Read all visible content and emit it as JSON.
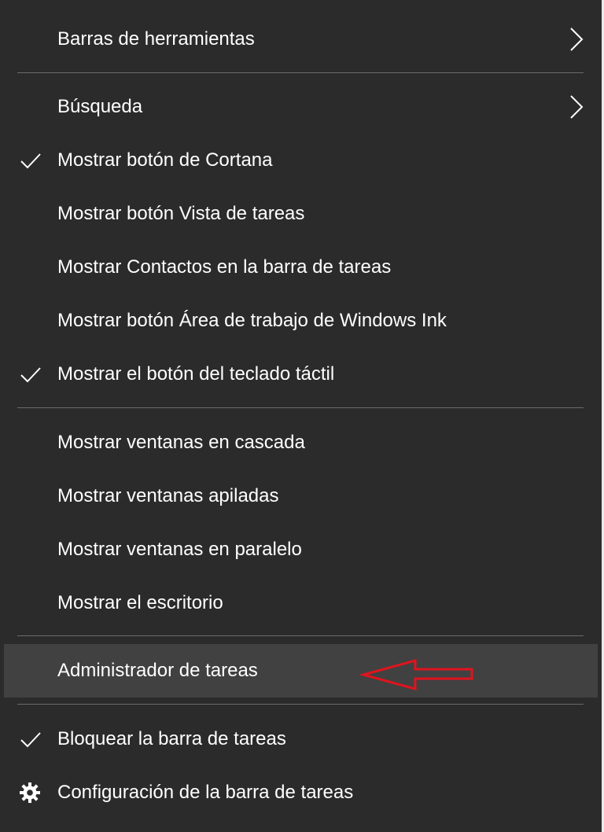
{
  "menu": {
    "items": [
      {
        "label": "Barras de herramientas",
        "checked": false,
        "submenu": true,
        "icon": "chevron-right-icon"
      },
      {
        "label": "Búsqueda",
        "checked": false,
        "submenu": true,
        "icon": "chevron-right-icon"
      },
      {
        "label": "Mostrar botón de Cortana",
        "checked": true,
        "icon": "checkmark-icon"
      },
      {
        "label": "Mostrar botón Vista de tareas",
        "checked": false
      },
      {
        "label": "Mostrar Contactos en la barra de tareas",
        "checked": false
      },
      {
        "label": "Mostrar botón Área de trabajo de Windows Ink",
        "checked": false
      },
      {
        "label": "Mostrar el botón del teclado táctil",
        "checked": true,
        "icon": "checkmark-icon"
      },
      {
        "label": "Mostrar ventanas en cascada",
        "checked": false
      },
      {
        "label": "Mostrar ventanas apiladas",
        "checked": false
      },
      {
        "label": "Mostrar ventanas en paralelo",
        "checked": false
      },
      {
        "label": "Mostrar el escritorio",
        "checked": false
      },
      {
        "label": "Administrador de tareas",
        "checked": false,
        "highlighted": true
      },
      {
        "label": "Bloquear la barra de tareas",
        "checked": true,
        "icon": "checkmark-icon"
      },
      {
        "label": "Configuración de la barra de tareas",
        "checked": false,
        "icon": "gear-icon"
      }
    ]
  },
  "annotation": {
    "icon": "red-arrow-left-icon",
    "color": "#e0141e",
    "points_to": "Administrador de tareas"
  },
  "colors": {
    "background": "#2b2b2b",
    "highlight": "#414141",
    "separator": "#6b6b6b",
    "text": "#ffffff"
  }
}
